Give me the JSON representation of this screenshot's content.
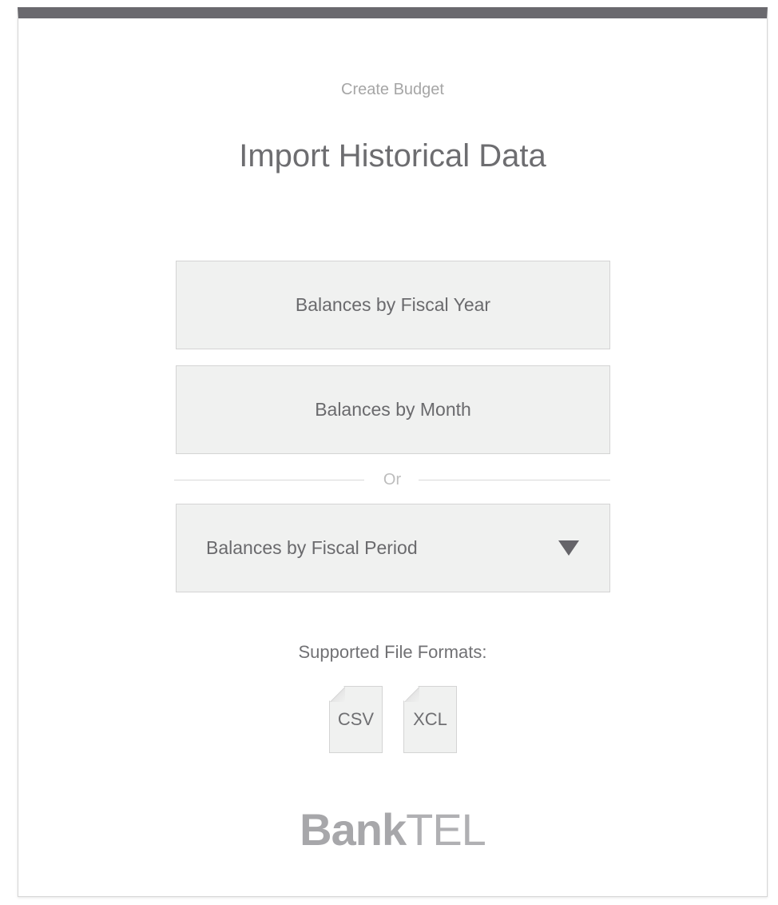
{
  "header": {
    "subtitle": "Create Budget",
    "title": "Import Historical Data"
  },
  "options": {
    "fiscal_year_label": "Balances by Fiscal Year",
    "month_label": "Balances by Month",
    "or_label": "Or",
    "fiscal_period_select": {
      "selected": "Balances by Fiscal Period",
      "icon": "caret-down-icon"
    }
  },
  "formats": {
    "label": "Supported File Formats:",
    "files": [
      "CSV",
      "XCL"
    ]
  },
  "brand": {
    "logo_bold": "Bank",
    "logo_thin": "TEL"
  },
  "colors": {
    "top_bar": "#6a696e",
    "button_bg": "#f0f1f0",
    "text": "#6a6a6d"
  }
}
